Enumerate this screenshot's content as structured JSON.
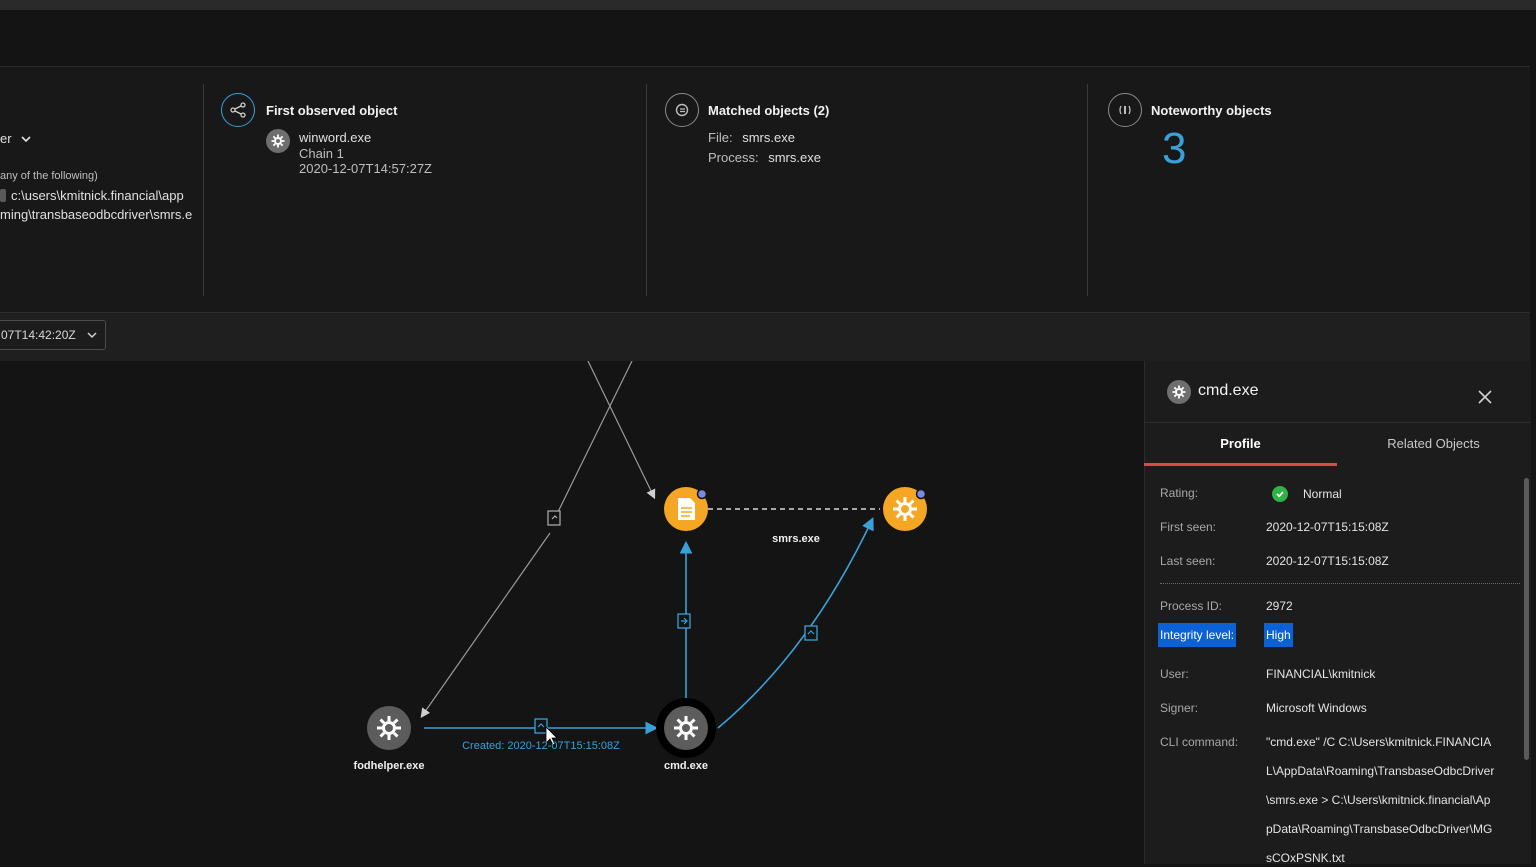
{
  "left_panel": {
    "dropdown_label": "er",
    "condition_hint": "any of the following)",
    "path_line1": "c:\\users\\kmitnick.financial\\app",
    "path_line2": "ming\\transbaseodbcdriver\\smrs.e"
  },
  "first_observed": {
    "title": "First observed object",
    "name": "winword.exe",
    "chain": "Chain 1",
    "timestamp": "2020-12-07T14:57:27Z"
  },
  "matched": {
    "title": "Matched objects (2)",
    "file_label": "File:",
    "file_value": "smrs.exe",
    "process_label": "Process:",
    "process_value": "smrs.exe"
  },
  "noteworthy": {
    "title": "Noteworthy objects",
    "count": "3"
  },
  "toolbar": {
    "date_value": "07T14:42:20Z"
  },
  "graph": {
    "nodes": {
      "smrs_label": "smrs.exe",
      "fodhelper_label": "fodhelper.exe",
      "cmd_label": "cmd.exe"
    },
    "edge_created_label": "Created: 2020-12-07T15:15:08Z"
  },
  "details": {
    "title": "cmd.exe",
    "tabs": [
      "Profile",
      "Related Objects"
    ],
    "rating_label": "Rating:",
    "rating_value": "Normal",
    "first_seen_label": "First seen:",
    "first_seen_value": "2020-12-07T15:15:08Z",
    "last_seen_label": "Last seen:",
    "last_seen_value": "2020-12-07T15:15:08Z",
    "pid_label": "Process ID:",
    "pid_value": "2972",
    "integrity_label": "Integrity level:",
    "integrity_value": "High",
    "user_label": "User:",
    "user_value": "FINANCIAL\\kmitnick",
    "signer_label": "Signer:",
    "signer_value": "Microsoft Windows",
    "cli_label": "CLI command:",
    "cli_lines": [
      "\"cmd.exe\" /C C:\\Users\\kmitnick.FINANCIA",
      "L\\AppData\\Roaming\\TransbaseOdbcDriver",
      "\\smrs.exe > C:\\Users\\kmitnick.financial\\Ap",
      "pData\\Roaming\\TransbaseOdbcDriver\\MG",
      "sCOxPSNK.txt"
    ]
  },
  "colors": {
    "accent_blue": "#3aa0d8",
    "node_orange": "#f5a623",
    "rating_green": "#2fb344",
    "tab_underline": "#e0474c",
    "highlight": "#0a62d6"
  }
}
